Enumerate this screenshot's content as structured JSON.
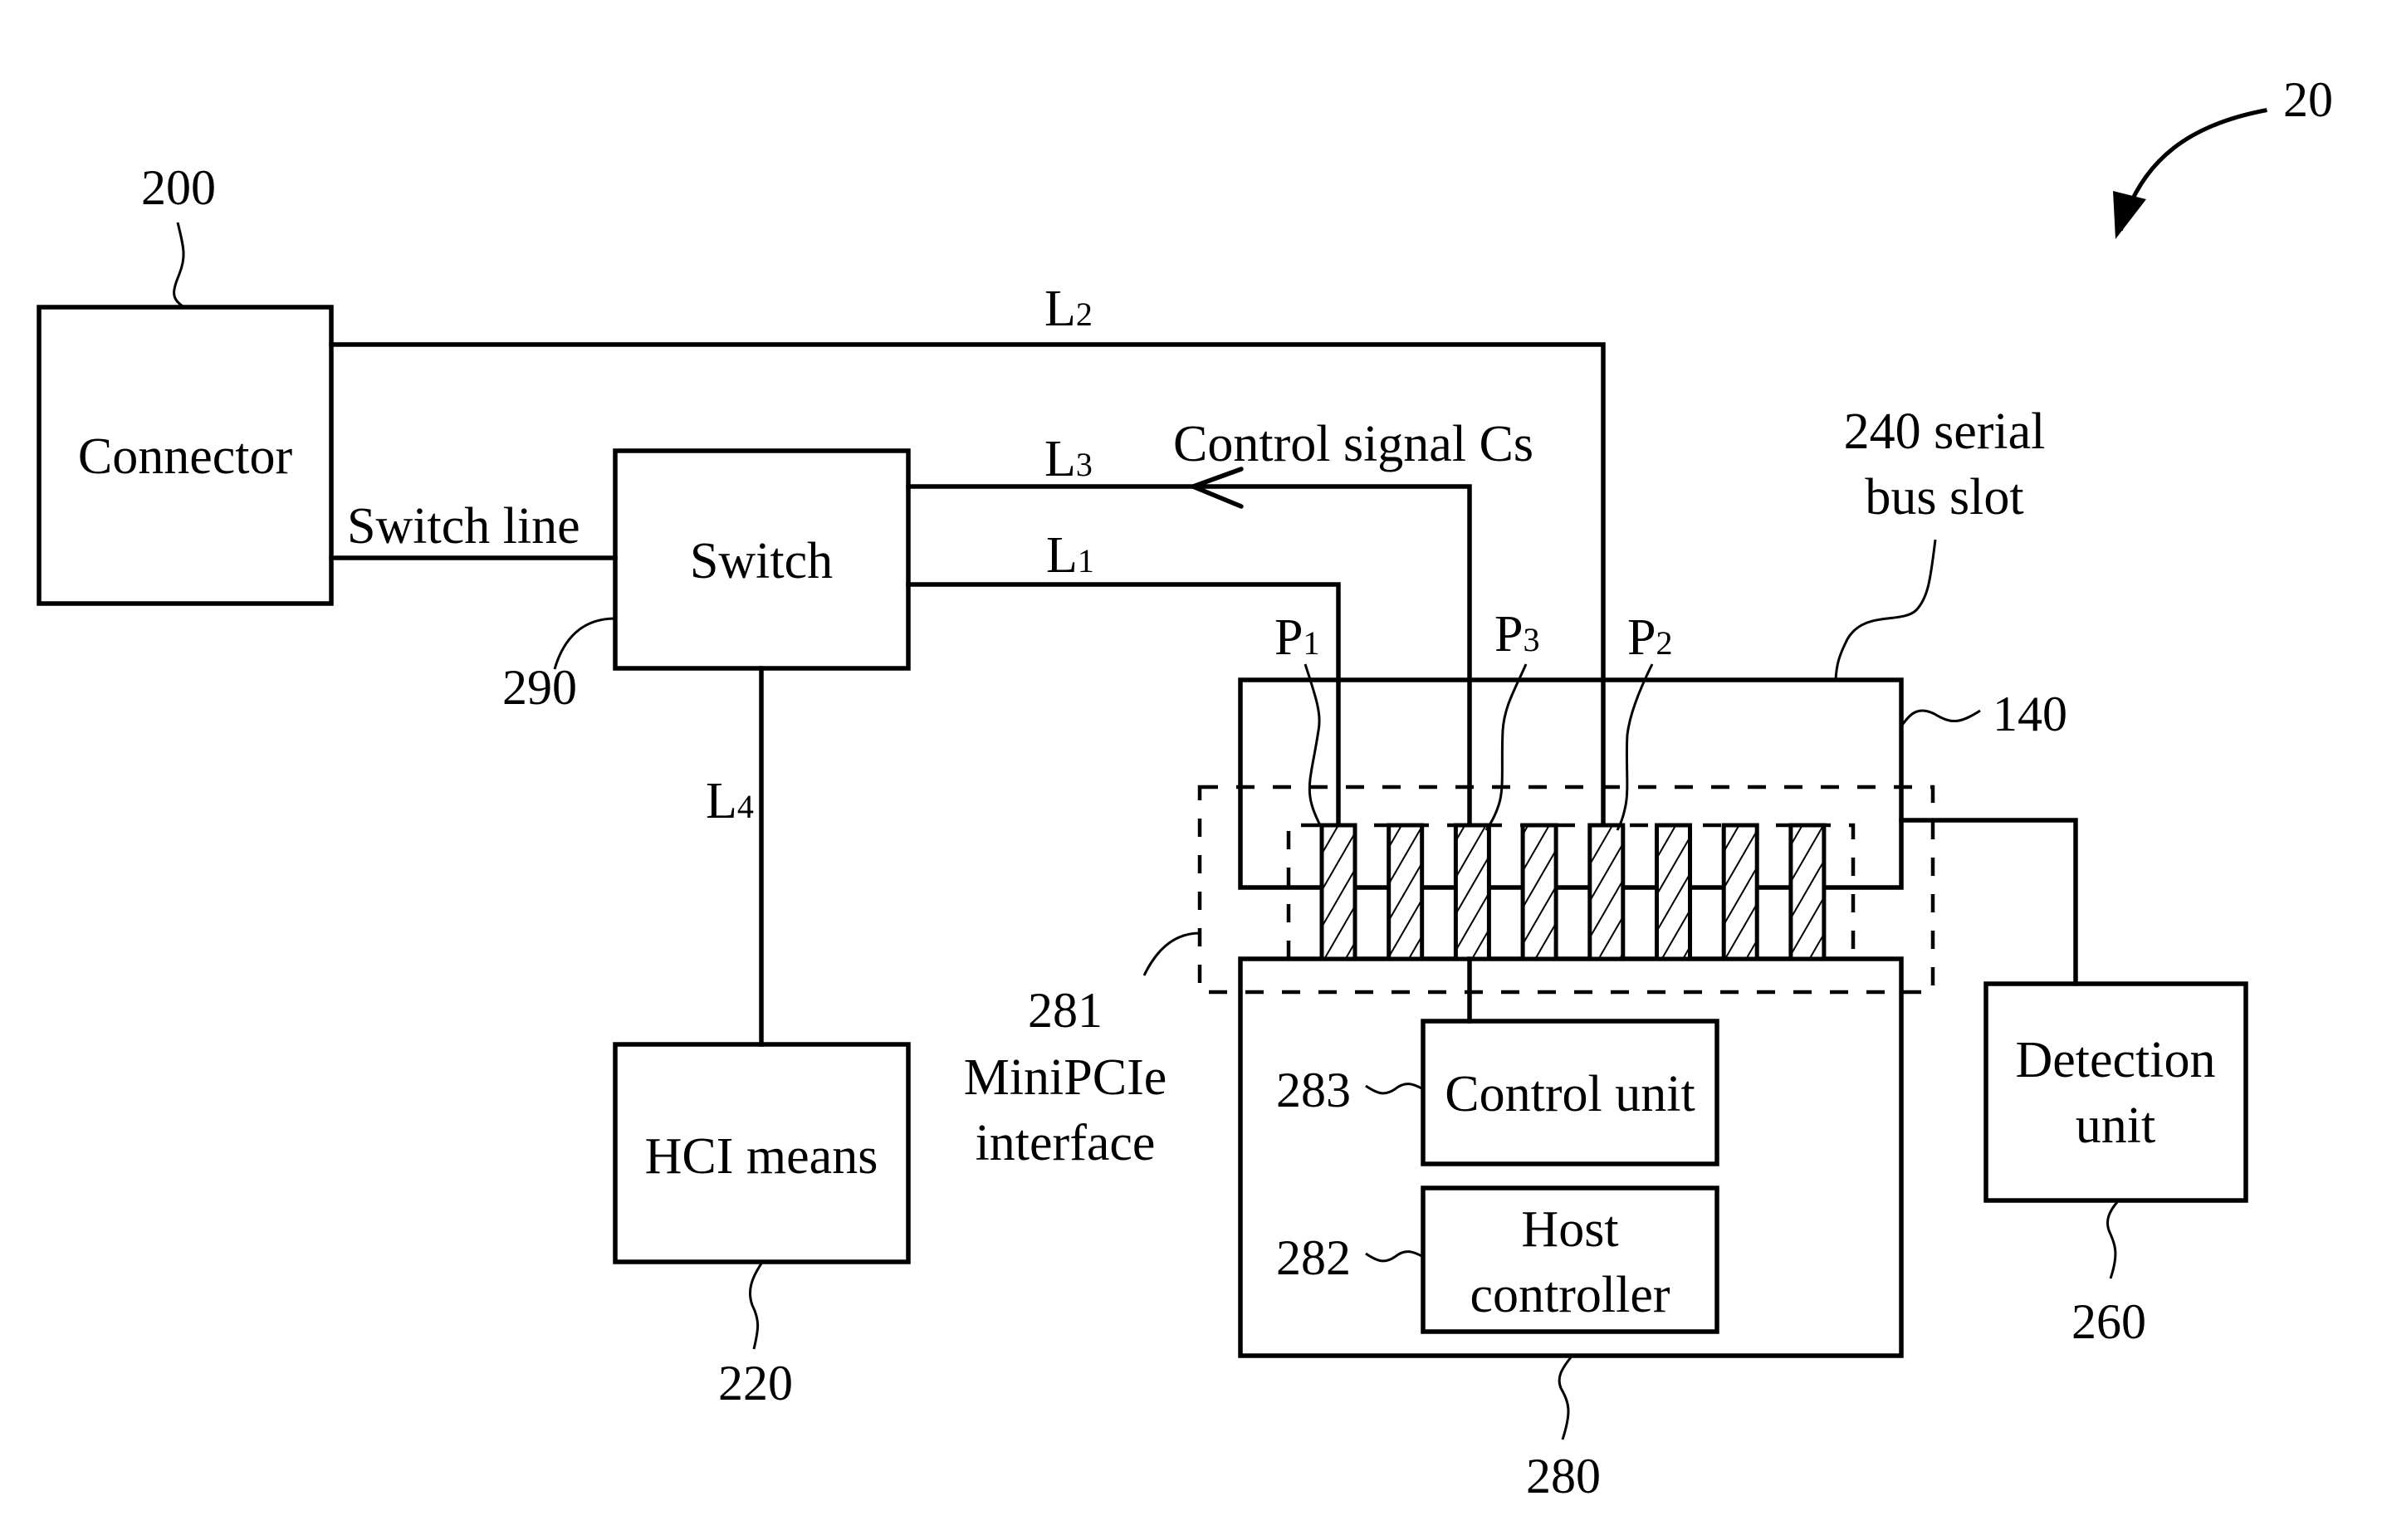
{
  "figure": {
    "ref": "20",
    "colors": {
      "ink": "#000000",
      "paper": "#ffffff"
    }
  },
  "blocks": {
    "connector": {
      "label": "Connector",
      "ref": "200"
    },
    "switch": {
      "label": "Switch",
      "ref": "290"
    },
    "hci": {
      "label": "HCI means",
      "ref": "220"
    },
    "slot": {
      "label_line1": "240 serial",
      "label_line2": "bus slot",
      "ref": "140"
    },
    "card": {
      "ref": "280"
    },
    "interface": {
      "ref": "281",
      "label_line1": "MiniPCIe",
      "label_line2": "interface"
    },
    "control_unit": {
      "label": "Control unit",
      "ref": "283"
    },
    "host_controller": {
      "label_line1": "Host",
      "label_line2": "controller",
      "ref": "282"
    },
    "detection": {
      "label_line1": "Detection",
      "label_line2": "unit",
      "ref": "260"
    }
  },
  "lines": {
    "switch_line": "Switch line",
    "l1": {
      "base": "L",
      "sub": "1"
    },
    "l2": {
      "base": "L",
      "sub": "2"
    },
    "l3": {
      "base": "L",
      "sub": "3"
    },
    "l4": {
      "base": "L",
      "sub": "4"
    },
    "control_signal": "Control signal Cs"
  },
  "pins": {
    "p1": {
      "base": "P",
      "sub": "1"
    },
    "p2": {
      "base": "P",
      "sub": "2"
    },
    "p3": {
      "base": "P",
      "sub": "3"
    },
    "count": 8
  }
}
